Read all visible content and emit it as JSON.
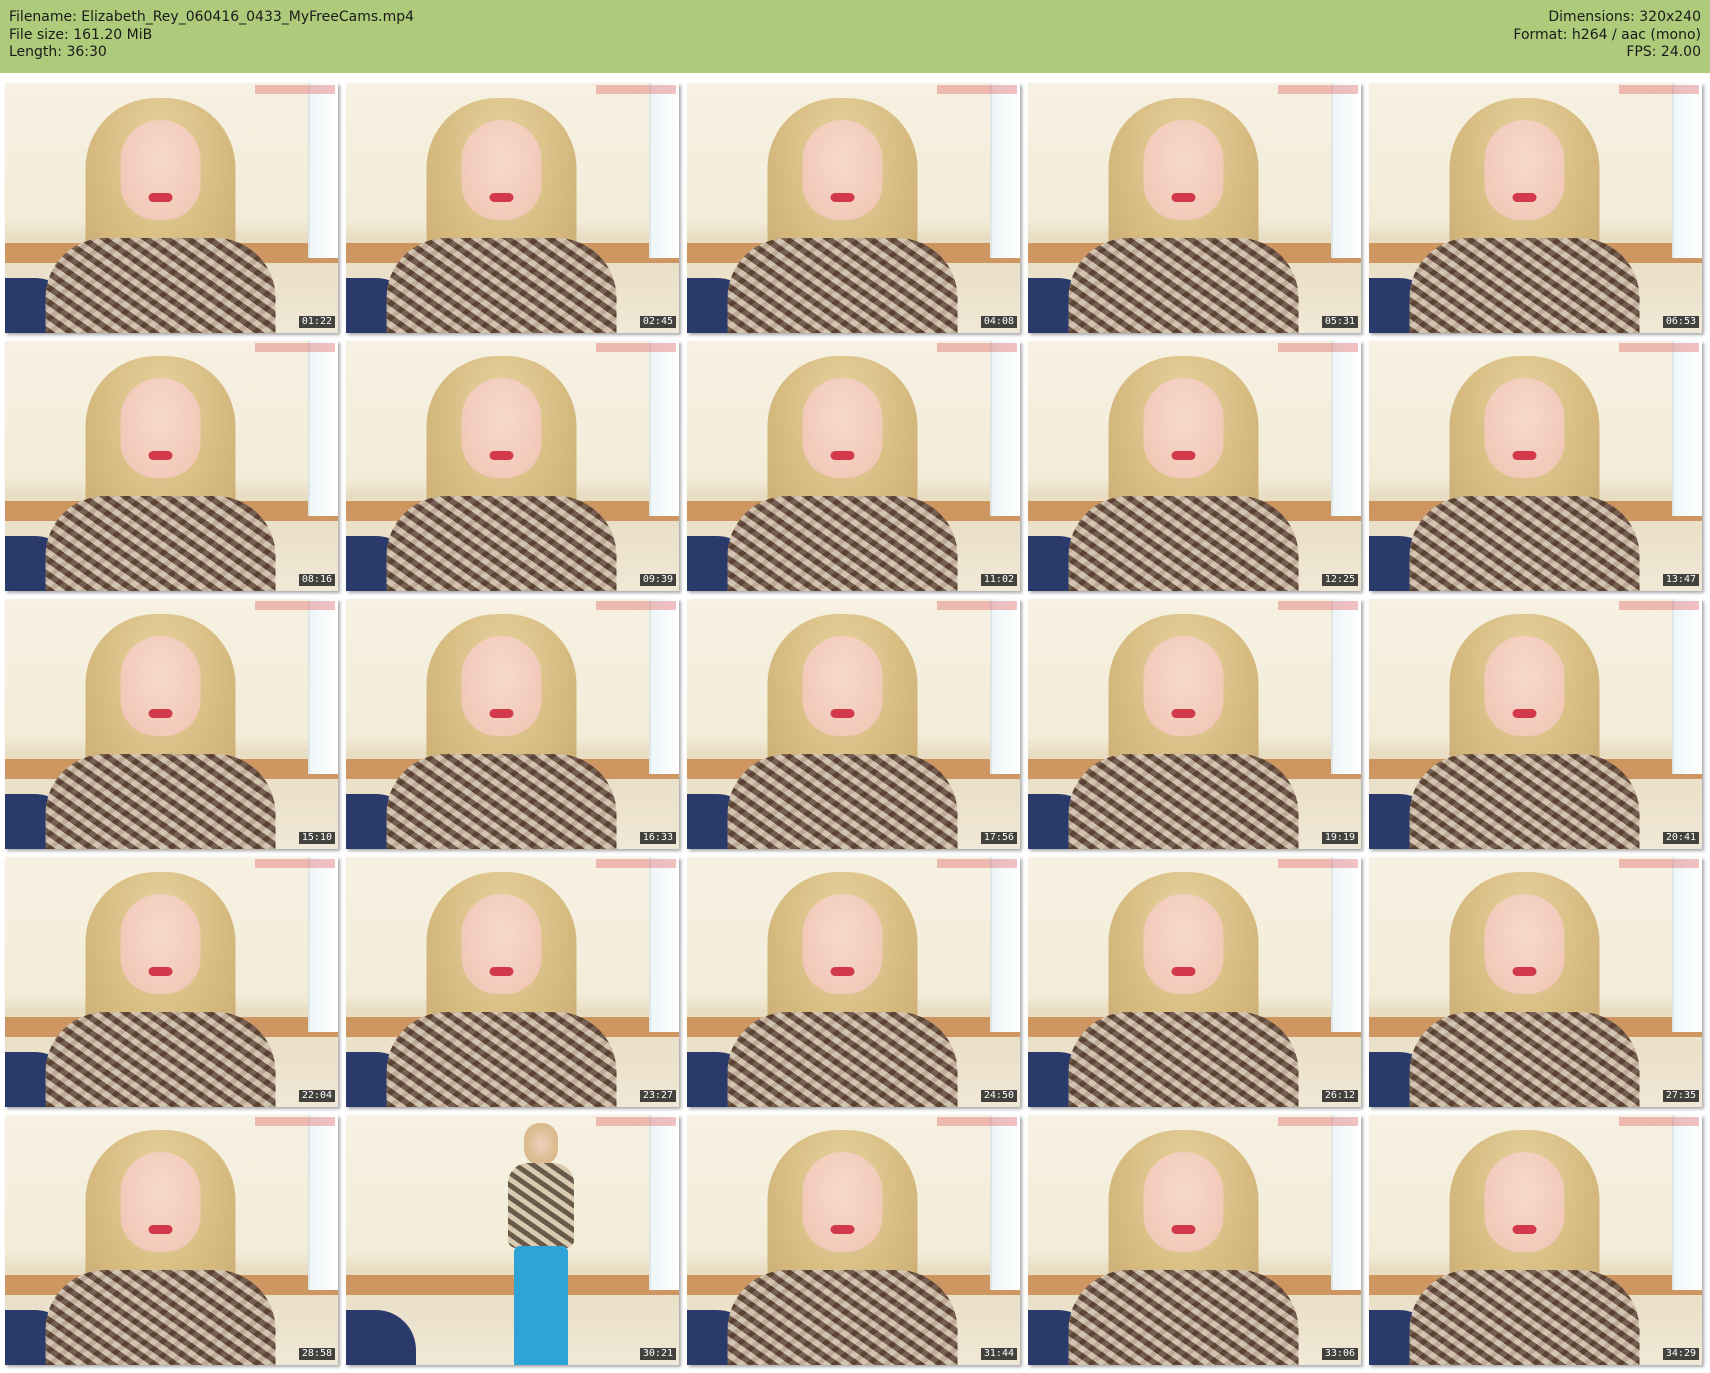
{
  "info": {
    "filename": "Filename: Elizabeth_Rey_060416_0433_MyFreeCams.mp4",
    "filesize": "File size: 161.20 MiB",
    "length": "Length: 36:30",
    "dimensions": "Dimensions: 320x240",
    "format": "Format: h264 / aac (mono)",
    "fps": "FPS: 24.00"
  },
  "colors": {
    "header_bg": "#aecb7b",
    "timestamp_bg": "#232323"
  },
  "thumbnails": [
    {
      "time": "01:22"
    },
    {
      "time": "02:45"
    },
    {
      "time": "04:08"
    },
    {
      "time": "05:31"
    },
    {
      "time": "06:53"
    },
    {
      "time": "08:16"
    },
    {
      "time": "09:39"
    },
    {
      "time": "11:02"
    },
    {
      "time": "12:25"
    },
    {
      "time": "13:47"
    },
    {
      "time": "15:10"
    },
    {
      "time": "16:33"
    },
    {
      "time": "17:56"
    },
    {
      "time": "19:19"
    },
    {
      "time": "20:41"
    },
    {
      "time": "22:04"
    },
    {
      "time": "23:27"
    },
    {
      "time": "24:50"
    },
    {
      "time": "26:12"
    },
    {
      "time": "27:35"
    },
    {
      "time": "28:58"
    },
    {
      "time": "30:21"
    },
    {
      "time": "31:44"
    },
    {
      "time": "33:06"
    },
    {
      "time": "34:29"
    }
  ]
}
